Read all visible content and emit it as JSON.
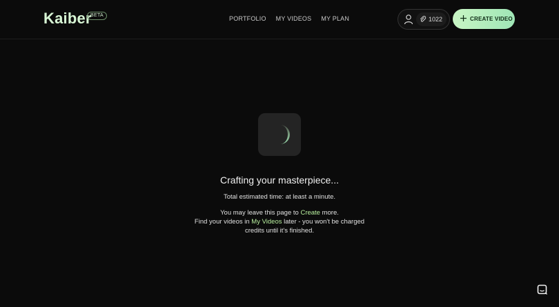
{
  "header": {
    "logo": "Kaiber",
    "badge": "BETA",
    "nav": [
      {
        "label": "PORTFOLIO"
      },
      {
        "label": "MY VIDEOS"
      },
      {
        "label": "MY PLAN"
      }
    ],
    "credits": "1022",
    "create_label": "CREATE VIDEO"
  },
  "main": {
    "heading": "Crafting your masterpiece...",
    "estimate": "Total estimated time: at least a minute.",
    "line1_pre": "You may leave this page to ",
    "line1_link": "Create",
    "line1_post": " more.",
    "line2_pre": "Find your videos in ",
    "line2_link": "My Videos",
    "line2_post": " later - you won't be charged",
    "line3": "credits until it's finished."
  },
  "colors": {
    "accent": "#b8ef9e",
    "background": "#0b0b0b",
    "button_gradient_start": "#c8f5c4",
    "button_gradient_end": "#9fe6b6"
  },
  "icons": {
    "user": "user-icon",
    "credits": "paperclip-icon",
    "create": "plus-icon",
    "spinner": "loading-spinner-icon",
    "chat": "chat-icon"
  }
}
